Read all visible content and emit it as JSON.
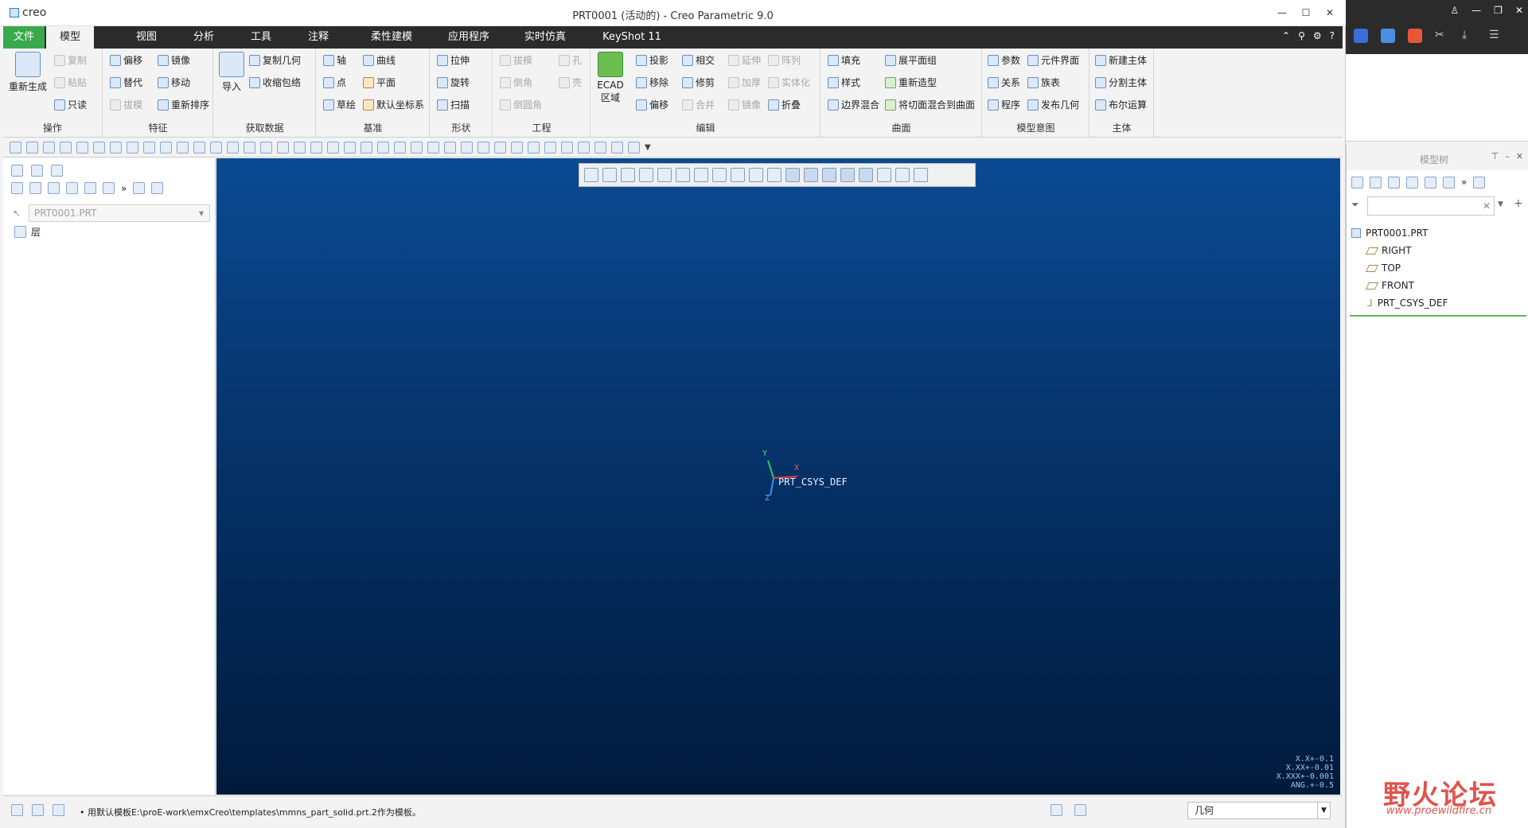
{
  "app": {
    "logo": "creo",
    "window_title": "PRT0001 (活动的) - Creo Parametric 9.0"
  },
  "window_buttons": [
    "?",
    "—",
    "☐",
    "✕"
  ],
  "tabs": [
    {
      "label": "文件"
    },
    {
      "label": "模型"
    },
    {
      "label": "视图"
    },
    {
      "label": "分析"
    },
    {
      "label": "工具"
    },
    {
      "label": "注释"
    },
    {
      "label": "柔性建模"
    },
    {
      "label": "应用程序"
    },
    {
      "label": "实时仿真"
    },
    {
      "label": "KeyShot 11"
    }
  ],
  "ribbon": {
    "ops": {
      "label": "操作",
      "regen": "重新生成",
      "copy": "复制",
      "paste": "粘贴",
      "readonly": "只读"
    },
    "feature": {
      "label": "特征",
      "offset": "偏移",
      "mirror": "镜像",
      "replace": "替代",
      "move": "移动",
      "draft": "拔模",
      "reorder": "重新排序"
    },
    "getdata": {
      "label": "获取数据",
      "import": "导入",
      "copygeom": "复制几何",
      "shrink": "收缩包络"
    },
    "datum": {
      "label": "基准",
      "axis": "轴",
      "curve": "曲线",
      "point": "点",
      "plane": "平面",
      "sketch": "草绘",
      "csys": "默认坐标系"
    },
    "shape": {
      "label": "形状",
      "extrude": "拉伸",
      "revolve": "旋转",
      "sweep": "扫描"
    },
    "eng": {
      "label": "工程",
      "draft": "拔模",
      "hole": "孔",
      "round": "倒角",
      "shell": "壳",
      "chamfer": "倒圆角"
    },
    "edit": {
      "label": "编辑",
      "ecad": "ECAD 区域",
      "project": "投影",
      "intersect": "相交",
      "extend": "延伸",
      "pattern": "阵列",
      "remove": "移除",
      "trim": "修剪",
      "thicken": "加厚",
      "solidify": "实体化",
      "offset": "偏移",
      "merge": "合并",
      "mirror": "镜像",
      "fold": "折叠"
    },
    "surface": {
      "label": "曲面",
      "fill": "填充",
      "flatten": "展平面组",
      "style": "样式",
      "restyle": "重新造型",
      "boundary": "边界混合",
      "blendtan": "将切面混合到曲面"
    },
    "intent": {
      "label": "模型意图",
      "params": "参数",
      "compiface": "元件界面",
      "relations": "关系",
      "familytable": "族表",
      "program": "程序",
      "publish": "发布几何"
    },
    "body": {
      "label": "主体",
      "newbody": "新建主体",
      "splitbody": "分割主体",
      "boolean": "布尔运算"
    }
  },
  "left_panel": {
    "part_combo": "PRT0001.PRT",
    "layer_label": "层"
  },
  "viewport": {
    "csys_label": "PRT_CSYS_DEF",
    "axis_x": "X",
    "axis_y": "Y",
    "axis_z": "Z",
    "tolerances": [
      "X.X+-0.1",
      "X.XX+-0.01",
      "X.XXX+-0.001",
      "ANG.+-0.5"
    ]
  },
  "model_tree": {
    "title": "模型树",
    "items": [
      {
        "label": "PRT0001.PRT"
      },
      {
        "label": "RIGHT"
      },
      {
        "label": "TOP"
      },
      {
        "label": "FRONT"
      },
      {
        "label": "PRT_CSYS_DEF"
      }
    ]
  },
  "status": {
    "message": "• 用默认模板E:\\proE-work\\emxCreo\\templates\\mmns_part_solid.prt.2作为模板。",
    "filter_value": "几何"
  },
  "watermark": {
    "text": "野火论坛",
    "url": "www.proewildfire.cn"
  },
  "colors": {
    "file_tab": "#3aa94b",
    "tab_bar": "#2b2b2b",
    "viewport_top": "#0b4a93",
    "viewport_bottom": "#001a3c"
  }
}
